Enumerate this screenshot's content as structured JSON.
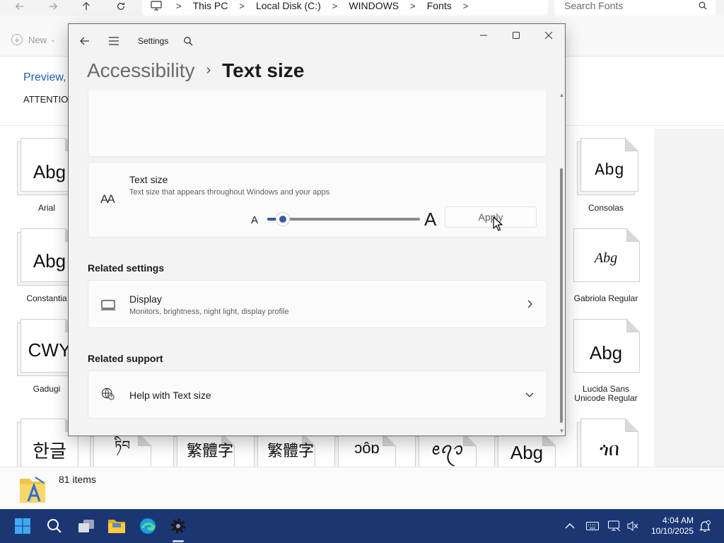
{
  "explorer": {
    "breadcrumb": [
      "This PC",
      "Local Disk (C:)",
      "WINDOWS",
      "Fonts"
    ],
    "search_placeholder": "Search Fonts",
    "toolbar": {
      "new_label": "New"
    },
    "preview_link": "Preview,",
    "attention_text": "ATTENTION",
    "fonts": [
      {
        "sample": "Abg",
        "label": "Arial"
      },
      {
        "sample": "Abg",
        "label": "Constantia"
      },
      {
        "sample": "CWY",
        "label": "Gadugi"
      },
      {
        "sample": "한글",
        "label": ""
      },
      {
        "sample": "ཏིབ",
        "label": ""
      },
      {
        "sample": "繁體字",
        "label": ""
      },
      {
        "sample": "繁體字",
        "label": ""
      },
      {
        "sample": "ɔôɒ",
        "label": ""
      },
      {
        "sample": "ꫀꪖꪫ",
        "label": ""
      },
      {
        "sample": "Abg",
        "label": ""
      },
      {
        "sample": "Abg",
        "label": "Consolas"
      },
      {
        "sample": "Abg",
        "label": "Gabriola Regular"
      },
      {
        "sample": "Abg",
        "label": "Lucida Sans Unicode Regular"
      },
      {
        "sample": "ጎበ",
        "label": ""
      }
    ],
    "status_count": "81 items"
  },
  "settings": {
    "app_title": "Settings",
    "breadcrumb_parent": "Accessibility",
    "breadcrumb_current": "Text size",
    "text_size": {
      "icon_glyph": "AA",
      "title": "Text size",
      "subtitle": "Text size that appears throughout Windows and your apps",
      "small_label": "A",
      "large_label": "A",
      "slider_fraction": 0.1,
      "apply_label": "Apply"
    },
    "related_settings": {
      "title": "Related settings",
      "display_title": "Display",
      "display_subtitle": "Monitors, brightness, night light, display profile"
    },
    "related_support": {
      "title": "Related support",
      "help_title": "Help with Text size"
    }
  },
  "taskbar": {
    "time": "4:04 AM",
    "date": "10/10/2025"
  },
  "colors": {
    "accent": "#3c5aa6",
    "taskbar": "#1b3673",
    "link": "#1a5fb4"
  }
}
